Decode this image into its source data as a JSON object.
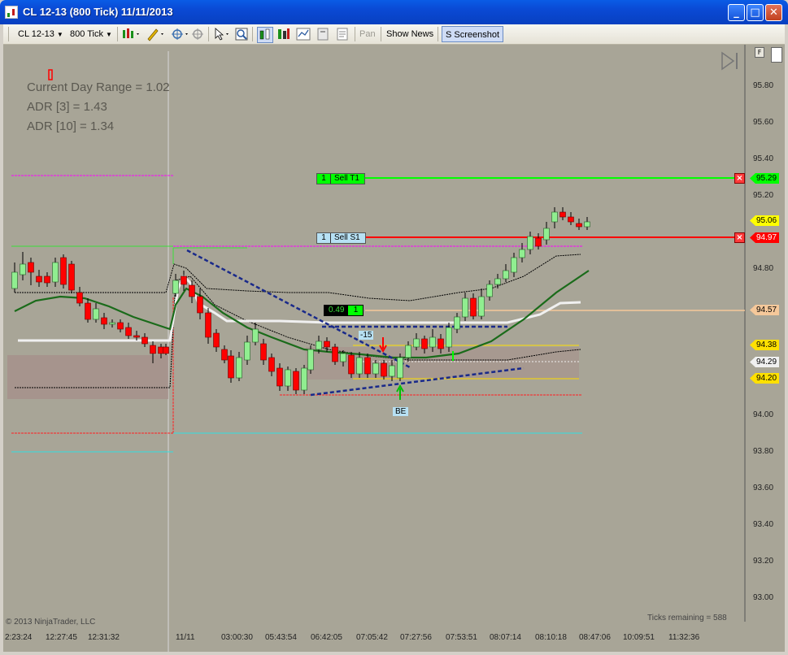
{
  "window": {
    "title": "CL 12-13 (800 Tick)  11/11/2013"
  },
  "toolbar": {
    "instrument": "CL 12-13",
    "period": "800 Tick",
    "pan_label": "Pan",
    "show_news_label": "Show News",
    "screenshot_label": "S Screenshot"
  },
  "chart": {
    "info": {
      "range": "Current Day Range = 1.02",
      "adr3": "ADR [3] = 1.43",
      "adr10": "ADR [10] = 1.34"
    },
    "y_ticks": [
      "95.80",
      "95.60",
      "95.40",
      "95.20",
      "94.80",
      "94.00",
      "93.80",
      "93.60",
      "93.40",
      "93.20",
      "93.00"
    ],
    "x_ticks": [
      "2:23:24",
      "12:27:45",
      "12:31:32",
      "11/11",
      "03:00:30",
      "05:43:54",
      "06:42:05",
      "07:05:42",
      "07:27:56",
      "07:53:51",
      "08:07:14",
      "08:10:18",
      "08:47:06",
      "10:09:51",
      "11:32:36"
    ],
    "price_tags": {
      "t1": "95.29",
      "last": "95.06",
      "s1": "94.97",
      "mid": "94.57",
      "y1": "94.38",
      "w1": "94.29",
      "y2": "94.20"
    },
    "orders": {
      "t1_qty": "1",
      "t1_name": "Sell T1",
      "s1_qty": "1",
      "s1_name": "Sell S1",
      "pos_value": "0.49",
      "pos_qty": "1"
    },
    "annotations": {
      "minus15": "-15",
      "be": "BE"
    },
    "copyright": "© 2013 NinjaTrader, LLC",
    "ticks_remaining": "Ticks remaining = 588",
    "scale_button": "F",
    "colors": {
      "background": "#a8a597",
      "up_candle": "#90ee90",
      "down_candle": "#ff0000",
      "ema": "#1a6b1a",
      "t1_line": "#00ff00",
      "s1_line": "#ff0000"
    }
  }
}
